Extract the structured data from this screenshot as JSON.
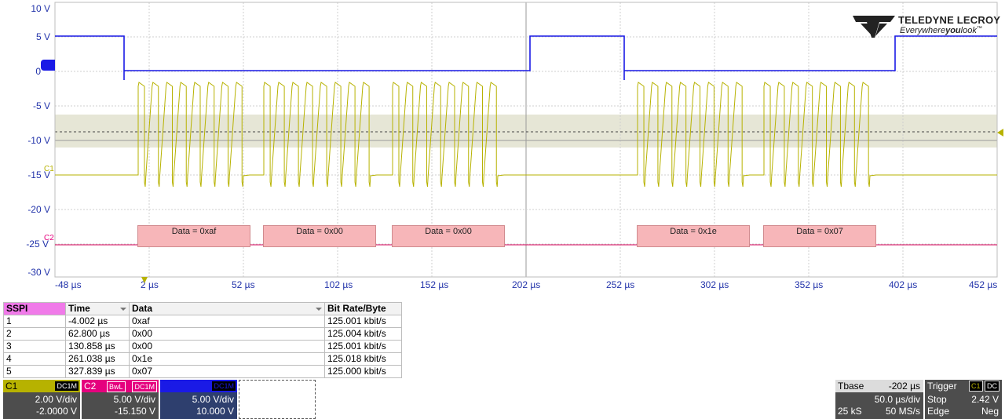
{
  "brand": {
    "name": "TELEDYNE LECROY",
    "tagline_prefix": "Everywhere",
    "tagline_bold": "you",
    "tagline_suffix": "look",
    "tm": "™"
  },
  "y_axis": {
    "labels": [
      "10 V",
      "5 V",
      "0",
      "-5 V",
      "-10 V",
      "-15 V",
      "-20 V",
      "-25 V",
      "-30 V"
    ]
  },
  "x_axis": {
    "labels": [
      "-48 µs",
      "2 µs",
      "52 µs",
      "102 µs",
      "152 µs",
      "202 µs",
      "252 µs",
      "302 µs",
      "352 µs",
      "402 µs",
      "452 µs"
    ]
  },
  "channel_markers": {
    "c1": "C1",
    "c2": "C2"
  },
  "decode_boxes": [
    "Data = 0xaf",
    "Data = 0x00",
    "Data = 0x00",
    "Data = 0x1e",
    "Data = 0x07"
  ],
  "table": {
    "headers": [
      "SSPI",
      "Time",
      "Data",
      "Bit Rate/Byte"
    ],
    "rows": [
      [
        "1",
        "-4.002 µs",
        "0xaf",
        "125.001 kbit/s"
      ],
      [
        "2",
        "62.800 µs",
        "0x00",
        "125.004 kbit/s"
      ],
      [
        "3",
        "130.858 µs",
        "0x00",
        "125.001 kbit/s"
      ],
      [
        "4",
        "261.038 µs",
        "0x1e",
        "125.018 kbit/s"
      ],
      [
        "5",
        "327.839 µs",
        "0x07",
        "125.000 kbit/s"
      ]
    ]
  },
  "channels": [
    {
      "name": "C1",
      "tags": [
        "DC1M"
      ],
      "vdiv": "2.00 V/div",
      "offset": "-2.0000 V",
      "color": "#b7b200"
    },
    {
      "name": "C2",
      "tags": [
        "BwL",
        "DC1M"
      ],
      "vdiv": "5.00 V/div",
      "offset": "-15.150 V",
      "color": "#e5007e"
    },
    {
      "name": "C4",
      "tags": [
        "DC1M"
      ],
      "vdiv": "5.00 V/div",
      "offset": "10.000 V",
      "color": "#1a1aff"
    }
  ],
  "timebase": {
    "label": "Tbase",
    "delay": "-202 µs",
    "tdiv": "50.0 µs/div",
    "samples": "25 kS",
    "rate": "50 MS/s"
  },
  "trigger": {
    "label": "Trigger",
    "tags": [
      "C1",
      "DC"
    ],
    "mode": "Stop",
    "level": "2.42 V",
    "type": "Edge",
    "slope": "Neg"
  },
  "colors": {
    "c1_trace": "#b7b200",
    "c2_trace": "#d6005a",
    "c4_trace": "#1a1ae6",
    "decode_fill": "#f7b6b9",
    "axis_text": "#2233aa",
    "sspi_header": "#f07ae9"
  }
}
